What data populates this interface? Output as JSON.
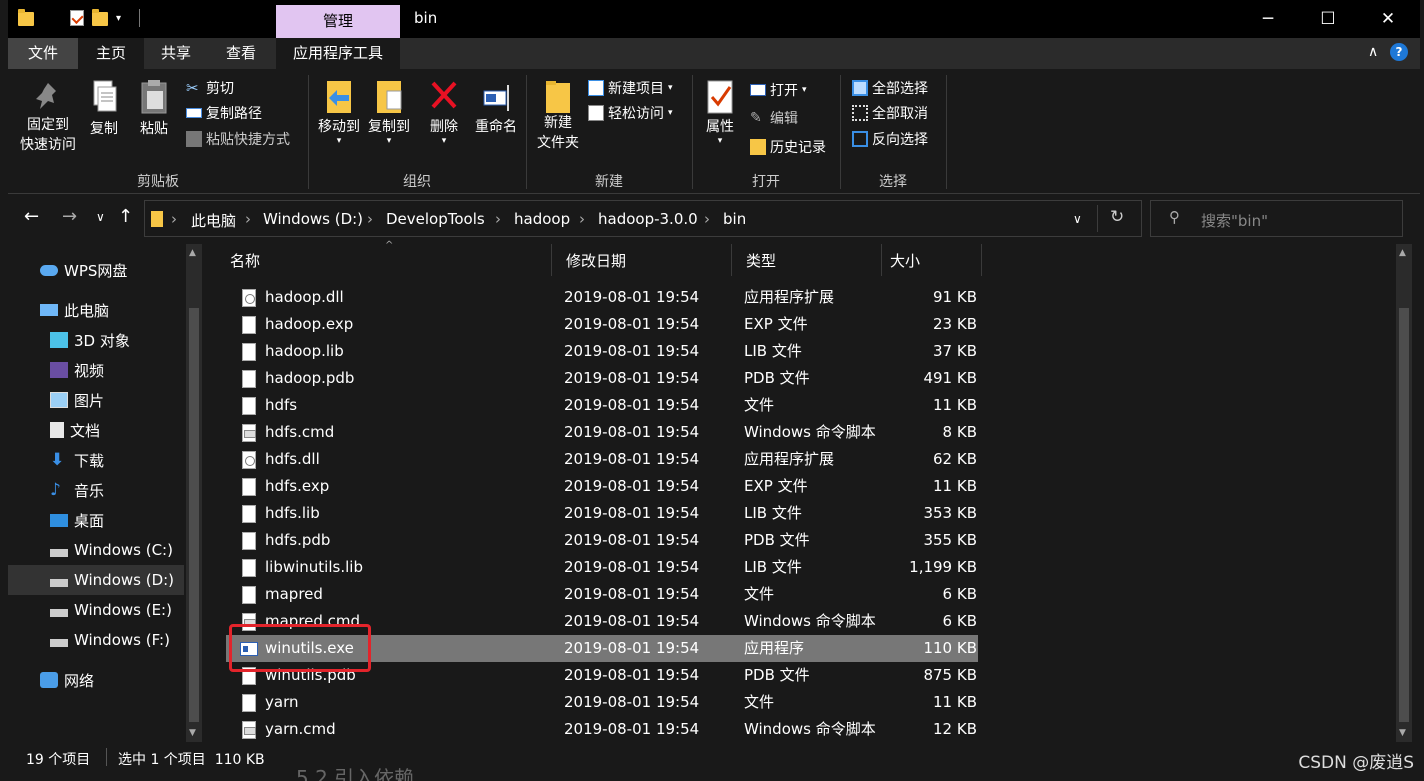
{
  "window": {
    "title": "bin",
    "context_tab": "管理",
    "controls": {
      "minimize": "─",
      "maximize": "☐",
      "close": "✕"
    }
  },
  "ribbon_tabs": [
    "文件",
    "主页",
    "共享",
    "查看",
    "应用程序工具"
  ],
  "ribbon": {
    "pin": "固定到\n快速访问",
    "copy": "复制",
    "paste": "粘贴",
    "cut": "剪切",
    "copy_path": "复制路径",
    "paste_shortcut": "粘贴快捷方式",
    "clipboard_group": "剪贴板",
    "move_to": "移动到",
    "copy_to": "复制到",
    "delete": "删除",
    "rename": "重命名",
    "organize_group": "组织",
    "new_folder": "新建\n文件夹",
    "new_item": "新建项目",
    "easy_access": "轻松访问",
    "new_group": "新建",
    "properties": "属性",
    "open": "打开",
    "edit": "编辑",
    "history": "历史记录",
    "open_group": "打开",
    "select_all": "全部选择",
    "select_none": "全部取消",
    "invert_selection": "反向选择",
    "select_group": "选择"
  },
  "address": {
    "crumbs": [
      "此电脑",
      "Windows (D:)",
      "DevelopTools",
      "hadoop",
      "hadoop-3.0.0",
      "bin"
    ],
    "search_placeholder": "搜索\"bin\""
  },
  "nav": [
    {
      "label": "WPS网盘",
      "icon": "cloud-icon"
    },
    {
      "label": "此电脑",
      "icon": "computer-icon"
    },
    {
      "label": "3D 对象",
      "icon": "cube-icon"
    },
    {
      "label": "视频",
      "icon": "video-icon"
    },
    {
      "label": "图片",
      "icon": "picture-icon"
    },
    {
      "label": "文档",
      "icon": "document-icon"
    },
    {
      "label": "下载",
      "icon": "download-icon"
    },
    {
      "label": "音乐",
      "icon": "music-icon"
    },
    {
      "label": "桌面",
      "icon": "desktop-icon"
    },
    {
      "label": "Windows (C:)",
      "icon": "drive-icon"
    },
    {
      "label": "Windows (D:)",
      "icon": "drive-icon"
    },
    {
      "label": "Windows (E:)",
      "icon": "drive-icon"
    },
    {
      "label": "Windows (F:)",
      "icon": "drive-icon"
    },
    {
      "label": "网络",
      "icon": "network-icon"
    }
  ],
  "columns": {
    "name": "名称",
    "date": "修改日期",
    "type": "类型",
    "size": "大小"
  },
  "files": [
    {
      "name": "hadoop.dll",
      "date": "2019-08-01 19:54",
      "type": "应用程序扩展",
      "size": "91 KB",
      "icon": "dll"
    },
    {
      "name": "hadoop.exp",
      "date": "2019-08-01 19:54",
      "type": "EXP 文件",
      "size": "23 KB",
      "icon": "file"
    },
    {
      "name": "hadoop.lib",
      "date": "2019-08-01 19:54",
      "type": "LIB 文件",
      "size": "37 KB",
      "icon": "file"
    },
    {
      "name": "hadoop.pdb",
      "date": "2019-08-01 19:54",
      "type": "PDB 文件",
      "size": "491 KB",
      "icon": "file"
    },
    {
      "name": "hdfs",
      "date": "2019-08-01 19:54",
      "type": "文件",
      "size": "11 KB",
      "icon": "file"
    },
    {
      "name": "hdfs.cmd",
      "date": "2019-08-01 19:54",
      "type": "Windows 命令脚本",
      "size": "8 KB",
      "icon": "cmd"
    },
    {
      "name": "hdfs.dll",
      "date": "2019-08-01 19:54",
      "type": "应用程序扩展",
      "size": "62 KB",
      "icon": "dll"
    },
    {
      "name": "hdfs.exp",
      "date": "2019-08-01 19:54",
      "type": "EXP 文件",
      "size": "11 KB",
      "icon": "file"
    },
    {
      "name": "hdfs.lib",
      "date": "2019-08-01 19:54",
      "type": "LIB 文件",
      "size": "353 KB",
      "icon": "file"
    },
    {
      "name": "hdfs.pdb",
      "date": "2019-08-01 19:54",
      "type": "PDB 文件",
      "size": "355 KB",
      "icon": "file"
    },
    {
      "name": "libwinutils.lib",
      "date": "2019-08-01 19:54",
      "type": "LIB 文件",
      "size": "1,199 KB",
      "icon": "file"
    },
    {
      "name": "mapred",
      "date": "2019-08-01 19:54",
      "type": "文件",
      "size": "6 KB",
      "icon": "file"
    },
    {
      "name": "mapred.cmd",
      "date": "2019-08-01 19:54",
      "type": "Windows 命令脚本",
      "size": "6 KB",
      "icon": "cmd"
    },
    {
      "name": "winutils.exe",
      "date": "2019-08-01 19:54",
      "type": "应用程序",
      "size": "110 KB",
      "icon": "exe",
      "selected": true
    },
    {
      "name": "winutils.pdb",
      "date": "2019-08-01 19:54",
      "type": "PDB 文件",
      "size": "875 KB",
      "icon": "file"
    },
    {
      "name": "yarn",
      "date": "2019-08-01 19:54",
      "type": "文件",
      "size": "11 KB",
      "icon": "file"
    },
    {
      "name": "yarn.cmd",
      "date": "2019-08-01 19:54",
      "type": "Windows 命令脚本",
      "size": "12 KB",
      "icon": "cmd"
    }
  ],
  "status": {
    "count": "19 个项目",
    "selection": "选中 1 个项目  110 KB"
  },
  "watermark": "CSDN @废逍S",
  "background_text": "5.2 引入依赖",
  "colors": {
    "accent": "#e1c5f1",
    "highlight_box": "#e3242b",
    "selected_row": "#777777"
  }
}
